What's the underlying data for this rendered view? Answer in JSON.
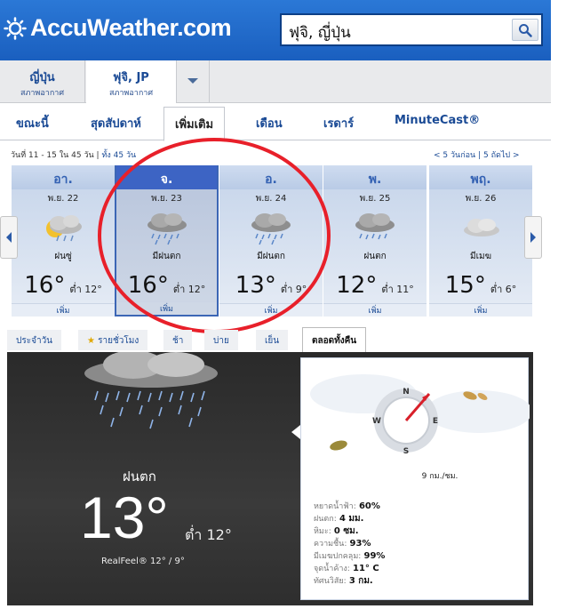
{
  "header": {
    "logo_text": "AccuWeather.com",
    "search_value": "ฟุจิ, ญี่ปุ่น",
    "brand_color": "#1e67c9"
  },
  "locations": [
    {
      "name": "ญี่ปุ่น",
      "sub": "สภาพอากาศ"
    },
    {
      "name": "ฟุจิ, JP",
      "sub": "สภาพอากาศ"
    }
  ],
  "tabs": [
    "ขณะนี้",
    "สุดสัปดาห์",
    "เพิ่มเติม",
    "เดือน",
    "เรดาร์",
    "MinuteCast®"
  ],
  "range": {
    "text": "วันที่ 11 - 15 ใน 45 วัน |",
    "all_link": "ทั้ง 45 วัน"
  },
  "nav": {
    "prev": "< 5 วันก่อน",
    "sep": "|",
    "next": "5 ถัดไป >"
  },
  "days": [
    {
      "dow": "อา.",
      "date": "พ.ย. 22",
      "cond": "ฝนซู่",
      "hi": "16°",
      "lo": "ต่ำ 12°",
      "more": "เพิ่ม",
      "icon": "sun-rain-icon"
    },
    {
      "dow": "จ.",
      "date": "พ.ย. 23",
      "cond": "มีฝนตก",
      "hi": "16°",
      "lo": "ต่ำ 12°",
      "more": "เพิ่ม",
      "icon": "rain-cloud-icon"
    },
    {
      "dow": "อ.",
      "date": "พ.ย. 24",
      "cond": "มีฝนตก",
      "hi": "13°",
      "lo": "ต่ำ 9°",
      "more": "เพิ่ม",
      "icon": "rain-cloud-icon"
    },
    {
      "dow": "พ.",
      "date": "พ.ย. 25",
      "cond": "ฝนตก",
      "hi": "12°",
      "lo": "ต่ำ 11°",
      "more": "เพิ่ม",
      "icon": "rain-cloud-icon"
    },
    {
      "dow": "พฤ.",
      "date": "พ.ย. 26",
      "cond": "มีเมฆ",
      "hi": "15°",
      "lo": "ต่ำ 6°",
      "more": "เพิ่ม",
      "icon": "cloud-icon"
    }
  ],
  "subtabs": [
    "ประจำวัน",
    "รายชั่วโมง",
    "ช้า",
    "บ่าย",
    "เย็น",
    "ตลอดทั้งคืน"
  ],
  "detail": {
    "condition": "ฝนตก",
    "temp": "13°",
    "low": "ต่ำ 12°",
    "realfeel": "RealFeel® 12° / 9°",
    "wind": "9 กม./ชม.",
    "compass": {
      "n": "N",
      "e": "E",
      "s": "S",
      "w": "W"
    },
    "stats": [
      {
        "label": "หยาดน้ำฟ้า:",
        "value": "60%"
      },
      {
        "label": "ฝนตก:",
        "value": "4 มม."
      },
      {
        "label": "หิมะ:",
        "value": "0 ซม."
      },
      {
        "label": "ความชื้น:",
        "value": "93%"
      },
      {
        "label": "มีเมฆปกคลุม:",
        "value": "99%"
      },
      {
        "label": "จุดน้ำค้าง:",
        "value": "11° C"
      },
      {
        "label": "ทัศนวิสัย:",
        "value": "3 กม."
      }
    ]
  },
  "annotation_color": "#e8202a"
}
